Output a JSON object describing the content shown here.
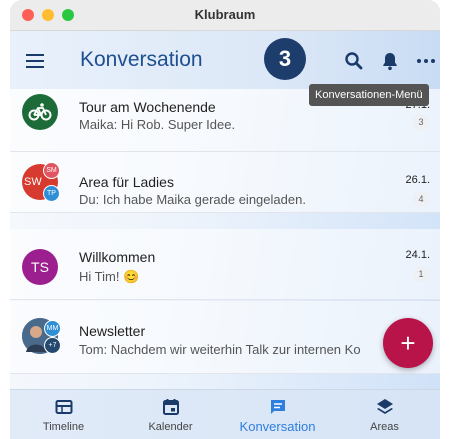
{
  "window": {
    "title": "Klubraum"
  },
  "appbar": {
    "title": "Konversation",
    "step_badge": "3",
    "tooltip": "Konversationen-Menü",
    "icons": {
      "menu": "hamburger-icon",
      "search": "search-icon",
      "notifications": "bell-icon",
      "more": "more-horizontal-icon"
    }
  },
  "conversations": [
    {
      "title": "Tour am Wochenende",
      "last_message": "Maika: Hi Rob. Super Idee.",
      "date": "27.1.",
      "unread": "3",
      "avatar_color": "#1d6b38",
      "avatar_icon": "bicycle-icon"
    },
    {
      "title": "Area für Ladies",
      "last_message": "Du: Ich habe Maika gerade eingeladen.",
      "date": "26.1.",
      "unread": "4",
      "avatar_text": "SW",
      "avatar_badges": [
        "SM",
        "TP"
      ],
      "avatar_color": "#d73a2f"
    },
    {
      "title": "Willkommen",
      "last_message": "Hi Tim! 😊",
      "date": "24.1.",
      "unread": "1",
      "avatar_text": "TS",
      "avatar_color": "#9b1f8e"
    },
    {
      "title": "Newsletter",
      "last_message": "Tom: Nachdem wir weiterhin Talk zur internen Ko",
      "avatar_badges": [
        "MM",
        "+7"
      ],
      "avatar_color": "#3b5c80"
    }
  ],
  "fab": {
    "label": "+"
  },
  "bottom_nav": [
    {
      "label": "Timeline",
      "icon": "timeline-icon"
    },
    {
      "label": "Kalender",
      "icon": "calendar-icon"
    },
    {
      "label": "Konversation",
      "icon": "chat-icon",
      "active": true
    },
    {
      "label": "Areas",
      "icon": "layers-icon"
    }
  ],
  "colors": {
    "primary": "#1e4f90",
    "accent": "#2e7ee0",
    "fab": "#b8144a",
    "badge": "#1d3d6d"
  }
}
